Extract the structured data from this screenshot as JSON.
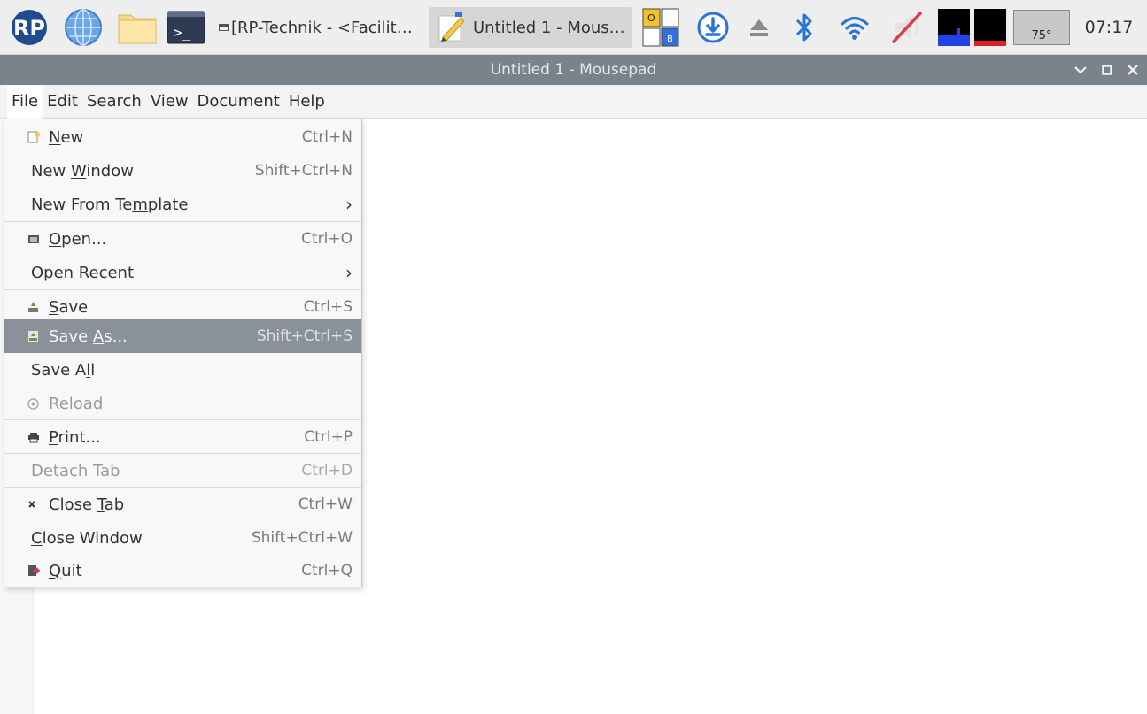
{
  "taskbar": {
    "launchers": [
      "raspberry-pi-menu-icon",
      "web-browser-icon",
      "file-manager-icon",
      "terminal-icon"
    ],
    "tasks": [
      {
        "title": "[RP-Technik - <Facilit…",
        "icon": "window-icon"
      },
      {
        "title": "Untitled 1 - Mous…",
        "icon": "mousepad-pen-icon",
        "active": true
      }
    ],
    "tray": {
      "ob_letters": [
        "O",
        "B"
      ],
      "icons": [
        "orange-blue-icon",
        "download-icon",
        "eject-icon",
        "bluetooth-icon",
        "wifi-icon",
        "volume-muted-icon",
        "cpu-monitor-icon",
        "cpu-monitor-icon",
        "temperature-icon"
      ],
      "temperature": "75°",
      "time": "07:17"
    }
  },
  "window": {
    "title": "Untitled 1 - Mousepad",
    "controls": [
      "minimize-icon",
      "maximize-icon",
      "close-icon"
    ]
  },
  "menubar": [
    "File",
    "Edit",
    "Search",
    "View",
    "Document",
    "Help"
  ],
  "file_menu": {
    "items": [
      {
        "pre": "",
        "u": "N",
        "post": "ew",
        "accel": "Ctrl+N",
        "icon": "new-document-icon"
      },
      {
        "pre": "New ",
        "u": "W",
        "post": "indow",
        "accel": "Shift+Ctrl+N"
      },
      {
        "pre": "New From Te",
        "u": "m",
        "post": "plate",
        "accel": "›"
      },
      {
        "pre": "",
        "u": "O",
        "post": "pen...",
        "accel": "Ctrl+O",
        "icon": "open-folder-icon"
      },
      {
        "pre": "Op",
        "u": "e",
        "post": "n Recent",
        "accel": "›"
      },
      {
        "pre": "",
        "u": "S",
        "post": "ave",
        "accel": "Ctrl+S",
        "icon": "save-icon"
      },
      {
        "pre": "Save ",
        "u": "A",
        "post": "s...",
        "accel": "Shift+Ctrl+S",
        "icon": "save-as-icon",
        "highlighted": true
      },
      {
        "pre": "Save A",
        "u": "l",
        "post": "l",
        "accel": ""
      },
      {
        "pre": "Reload",
        "u": "",
        "post": "",
        "accel": "",
        "icon": "reload-icon",
        "disabled": true
      },
      {
        "pre": "",
        "u": "P",
        "post": "rint...",
        "accel": "Ctrl+P",
        "icon": "printer-icon"
      },
      {
        "pre": "Detach Tab",
        "u": "",
        "post": "",
        "accel": "Ctrl+D",
        "disabled": true
      },
      {
        "pre": "Close ",
        "u": "T",
        "post": "ab",
        "accel": "Ctrl+W",
        "icon": "close-tab-icon"
      },
      {
        "pre": "",
        "u": "C",
        "post": "lose Window",
        "accel": "Shift+Ctrl+W"
      },
      {
        "pre": "",
        "u": "Q",
        "post": "uit",
        "accel": "Ctrl+Q",
        "icon": "quit-icon"
      }
    ]
  },
  "colors": {
    "titlebar": "#7a828b",
    "highlight": "#8a9199",
    "panel": "#eeeeee",
    "menu_bg": "#f8f8f8"
  }
}
